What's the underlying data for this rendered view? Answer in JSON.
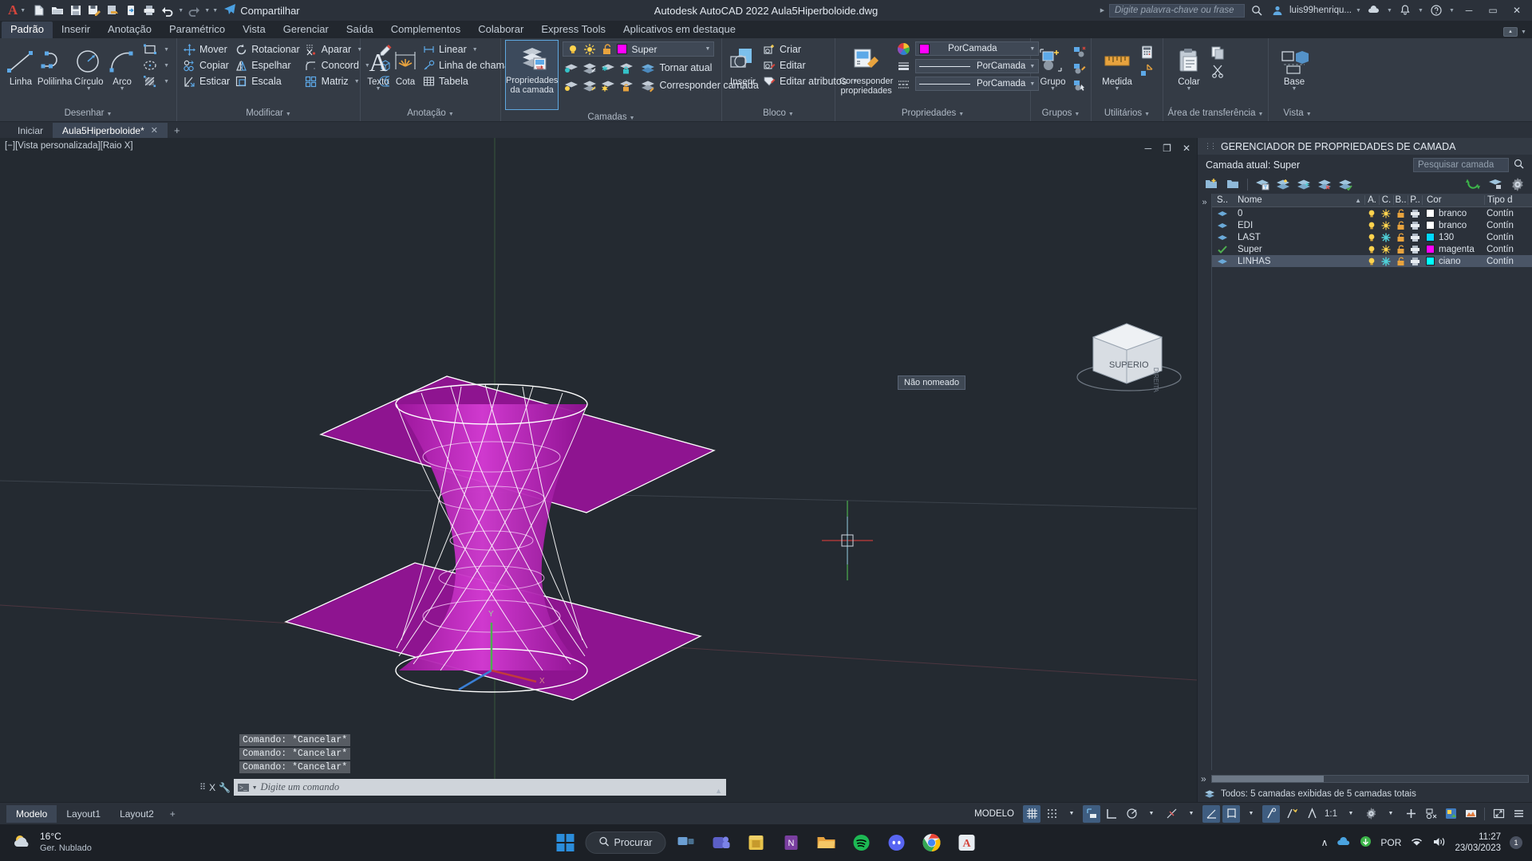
{
  "titlebar": {
    "app_logo": "autocad-a-logo",
    "quick_access": [
      {
        "name": "new-icon",
        "label": "Novo"
      },
      {
        "name": "open-icon",
        "label": "Abrir"
      },
      {
        "name": "save-icon",
        "label": "Salvar"
      },
      {
        "name": "saveas-icon",
        "label": "Salvar como"
      },
      {
        "name": "export-icon",
        "label": "Exportar"
      },
      {
        "name": "cloud-icon",
        "label": "Web e Mobile"
      },
      {
        "name": "plot-icon",
        "label": "Plotar"
      },
      {
        "name": "undo-icon",
        "label": "Desfazer"
      },
      {
        "name": "redo-icon",
        "label": "Refazer"
      }
    ],
    "share_label": "Compartilhar",
    "title": "Autodesk AutoCAD 2022    Aula5Hiperboloide.dwg",
    "search_placeholder": "Digite palavra-chave ou frase",
    "user_label": "luis99henriqu...",
    "window_buttons": [
      "minimize",
      "maximize",
      "close"
    ]
  },
  "menu": {
    "tabs": [
      {
        "label": "Padrão",
        "active": true
      },
      {
        "label": "Inserir",
        "active": false
      },
      {
        "label": "Anotação",
        "active": false
      },
      {
        "label": "Paramétrico",
        "active": false
      },
      {
        "label": "Vista",
        "active": false
      },
      {
        "label": "Gerenciar",
        "active": false
      },
      {
        "label": "Saída",
        "active": false
      },
      {
        "label": "Complementos",
        "active": false
      },
      {
        "label": "Colaborar",
        "active": false
      },
      {
        "label": "Express Tools",
        "active": false
      },
      {
        "label": "Aplicativos em destaque",
        "active": false
      }
    ]
  },
  "ribbon": {
    "panels": [
      {
        "title": "Desenhar",
        "big": [
          {
            "label": "Linha",
            "icon": "line-icon"
          },
          {
            "label": "Polilinha",
            "icon": "polyline-icon"
          },
          {
            "label": "Círculo",
            "icon": "circle-icon",
            "dropdown": true
          },
          {
            "label": "Arco",
            "icon": "arc-icon",
            "dropdown": true
          }
        ],
        "small": [
          {
            "label": "",
            "icon": "rectangle-icon",
            "dropdown": true
          },
          {
            "label": "",
            "icon": "ellipse-icon",
            "dropdown": true
          },
          {
            "label": "",
            "icon": "hatch-icon",
            "dropdown": true
          }
        ]
      },
      {
        "title": "Modificar",
        "rows": [
          [
            {
              "label": "Mover",
              "icon": "move-icon"
            },
            {
              "label": "Rotacionar",
              "icon": "rotate-icon"
            },
            {
              "label": "Aparar",
              "icon": "trim-icon",
              "dropdown": true
            },
            {
              "label": "",
              "icon": "erase-icon"
            }
          ],
          [
            {
              "label": "Copiar",
              "icon": "copy-icon"
            },
            {
              "label": "Espelhar",
              "icon": "mirror-icon"
            },
            {
              "label": "Concord",
              "icon": "fillet-icon",
              "dropdown": true
            },
            {
              "label": "",
              "icon": "3dsolid-icon"
            }
          ],
          [
            {
              "label": "Esticar",
              "icon": "stretch-icon"
            },
            {
              "label": "Escala",
              "icon": "scale-icon"
            },
            {
              "label": "Matriz",
              "icon": "array-icon",
              "dropdown": true
            },
            {
              "label": "",
              "icon": "offset-icon"
            }
          ]
        ]
      },
      {
        "title": "Anotação",
        "big": [
          {
            "label": "Texto",
            "icon": "text-icon",
            "dropdown": true
          },
          {
            "label": "Cota",
            "icon": "dimension-icon"
          }
        ],
        "rows": [
          [
            {
              "label": "Linear",
              "icon": "linear-dim-icon",
              "dropdown": true
            }
          ],
          [
            {
              "label": "Linha de chamada",
              "icon": "leader-icon",
              "dropdown": true
            }
          ],
          [
            {
              "label": "Tabela",
              "icon": "table-icon"
            }
          ]
        ]
      },
      {
        "title": "Camadas",
        "big": [
          {
            "label": "Propriedades da camada",
            "icon": "layer-properties-icon",
            "active": true
          }
        ],
        "layer_combo": {
          "name": "Super",
          "color": "#ff00ff",
          "on": true,
          "freeze": false,
          "lock": false
        },
        "rows": [
          [
            {
              "label": "Tornar atual",
              "icon": "layer-make-current-icon"
            }
          ],
          [
            {
              "label": "Corresponder camada",
              "icon": "layer-match-icon"
            }
          ]
        ],
        "state_icons_row1": [
          "layer-isolate-icon",
          "layer-unisolate-icon",
          "layer-freeze-icon",
          "layer-lock-icon"
        ],
        "state_icons_row2": [
          "layer-off-icon",
          "layer-turn-on-icon",
          "layer-thaw-icon",
          "layer-unlock-icon"
        ]
      },
      {
        "title": "Bloco",
        "big": [
          {
            "label": "Inserir",
            "icon": "insert-block-icon",
            "dropdown": true
          }
        ],
        "rows": [
          [
            {
              "label": "Criar",
              "icon": "block-create-icon"
            }
          ],
          [
            {
              "label": "Editar",
              "icon": "block-edit-icon"
            }
          ],
          [
            {
              "label": "Editar atributos",
              "icon": "block-attrib-icon",
              "dropdown": true
            }
          ]
        ]
      },
      {
        "title": "Propriedades",
        "big": [
          {
            "label": "Corresponder propriedades",
            "icon": "match-properties-icon"
          }
        ],
        "combos": [
          {
            "label": "PorCamada",
            "icon": "color-wheel-icon",
            "swatch": "#ff00ff"
          },
          {
            "label": "PorCamada",
            "icon": "lineweight-icon",
            "line": true
          },
          {
            "label": "PorCamada",
            "icon": "linetype-icon",
            "line": true
          }
        ]
      },
      {
        "title": "Grupos",
        "big": [
          {
            "label": "Grupo",
            "icon": "group-icon",
            "dropdown": true
          }
        ],
        "small": [
          {
            "icon": "ungroup-icon"
          },
          {
            "icon": "group-edit-icon"
          },
          {
            "icon": "group-select-icon"
          }
        ]
      },
      {
        "title": "Utilitários",
        "big": [
          {
            "label": "Medida",
            "icon": "measure-icon",
            "dropdown": true
          }
        ],
        "small": [
          {
            "icon": "quickcalc-icon"
          },
          {
            "icon": "id-point-icon"
          }
        ]
      },
      {
        "title": "Área de transferência",
        "big": [
          {
            "label": "Colar",
            "icon": "paste-icon",
            "dropdown": true
          }
        ],
        "small": [
          {
            "icon": "copy-clip-icon"
          },
          {
            "icon": "cut-clip-icon"
          }
        ]
      },
      {
        "title": "Vista",
        "big": [
          {
            "label": "Base",
            "icon": "base-view-icon",
            "dropdown": true
          }
        ]
      }
    ]
  },
  "doctabs": {
    "tabs": [
      {
        "label": "Iniciar",
        "active": false,
        "closable": false
      },
      {
        "label": "Aula5Hiperboloide*",
        "active": true,
        "closable": true
      }
    ],
    "add_label": "+"
  },
  "viewport": {
    "label": "[−][Vista personalizada][Raio X]",
    "viewcube_face": "SUPERIOR",
    "viewcube_side": "DIREITA",
    "tooltip": "Não nomeado",
    "controls": [
      "minimize",
      "restore",
      "close"
    ],
    "model_color_main": "#a0179f",
    "model_color_light": "#c92fc8",
    "wire_color": "#ffffff"
  },
  "command": {
    "history": [
      "Comando: *Cancelar*",
      "Comando: *Cancelar*",
      "Comando: *Cancelar*"
    ],
    "placeholder": "Digite um comando",
    "close_label": "X"
  },
  "palette": {
    "title": "GERENCIADOR DE PROPRIEDADES DE CAMADA",
    "current_layer": "Camada atual: Super",
    "search_placeholder": "Pesquisar camada",
    "toolbar_icons": [
      "new-layer-icon",
      "new-layer-vp-icon",
      "delete-layer-icon",
      "set-current-icon",
      "new-property-filter-icon",
      "new-group-filter-icon",
      "layer-states-icon"
    ],
    "right_icons": [
      "refresh-icon",
      "apply-icon",
      "settings-icon"
    ],
    "filter_toggle": "»",
    "columns": [
      "S..",
      "Nome",
      "A.",
      "C.",
      "B..",
      "P..",
      "Cor",
      "Tipo d"
    ],
    "rows": [
      {
        "status": "layer",
        "name": "0",
        "on": "on",
        "freeze": "thaw",
        "lock": "unlocked",
        "plot": "plot",
        "color_name": "branco",
        "color": "#ffffff",
        "linetype": "Contín",
        "selected": false,
        "current": false
      },
      {
        "status": "layer",
        "name": "EDI",
        "on": "on",
        "freeze": "thaw",
        "lock": "unlocked",
        "plot": "plot",
        "color_name": "branco",
        "color": "#ffffff",
        "linetype": "Contín",
        "selected": false,
        "current": false
      },
      {
        "status": "layer",
        "name": "LAST",
        "on": "on",
        "freeze": "frozen",
        "lock": "unlocked",
        "plot": "plot",
        "color_name": "130",
        "color": "#00d8ff",
        "linetype": "Contín",
        "selected": false,
        "current": false
      },
      {
        "status": "current",
        "name": "Super",
        "on": "on",
        "freeze": "thaw",
        "lock": "unlocked",
        "plot": "plot",
        "color_name": "magenta",
        "color": "#ff00ff",
        "linetype": "Contín",
        "selected": false,
        "current": true
      },
      {
        "status": "layer",
        "name": "LINHAS",
        "on": "on",
        "freeze": "frozen",
        "lock": "unlocked",
        "plot": "plot",
        "color_name": "ciano",
        "color": "#00ffff",
        "linetype": "Contín",
        "selected": true,
        "current": false
      }
    ],
    "status_text": "Todos: 5 camadas exibidas de 5 camadas totais",
    "collapse_label": "»"
  },
  "statusbar": {
    "layout_tabs": [
      {
        "label": "Modelo",
        "active": true
      },
      {
        "label": "Layout1",
        "active": false
      },
      {
        "label": "Layout2",
        "active": false
      }
    ],
    "add_layout": "+",
    "space_label": "MODELO",
    "scale": "1:1",
    "toggles": [
      {
        "name": "grid-toggle",
        "on": true
      },
      {
        "name": "snap-toggle",
        "on": false
      },
      {
        "name": "ortho-toggle",
        "on": true
      },
      {
        "name": "polar-tracking-toggle",
        "on": false
      },
      {
        "name": "osnap-toggle",
        "on": false
      },
      {
        "name": "otrack-toggle",
        "on": false
      },
      {
        "name": "ucs-icon-toggle",
        "on": true
      },
      {
        "name": "dynamic-input-toggle",
        "on": true
      },
      {
        "name": "annotation-visibility-toggle",
        "on": true
      },
      {
        "name": "autoscale-toggle",
        "on": false
      },
      {
        "name": "annotation-scale-toggle",
        "on": false
      },
      {
        "name": "workspace-switch",
        "on": false
      },
      {
        "name": "customization-icon",
        "on": false
      },
      {
        "name": "isolate-objects-icon",
        "on": false
      },
      {
        "name": "hardware-accel-icon",
        "on": false
      },
      {
        "name": "cleanscreen-icon",
        "on": false
      }
    ]
  },
  "taskbar": {
    "weather_temp": "16°C",
    "weather_desc": "Ger. Nublado",
    "search_label": "Procurar",
    "apps": [
      {
        "name": "start-icon",
        "label": "Iniciar"
      },
      {
        "name": "search-pill",
        "label": "Procurar"
      },
      {
        "name": "taskview-icon",
        "label": "Visão de tarefas"
      },
      {
        "name": "teams-icon",
        "label": "Teams"
      },
      {
        "name": "store-icon",
        "label": "Microsoft Store"
      },
      {
        "name": "onenote-icon",
        "label": "OneNote"
      },
      {
        "name": "explorer-icon",
        "label": "Explorador de Arquivos"
      },
      {
        "name": "spotify-icon",
        "label": "Spotify"
      },
      {
        "name": "discord-icon",
        "label": "Discord"
      },
      {
        "name": "chrome-icon",
        "label": "Google Chrome"
      },
      {
        "name": "autocad-icon",
        "label": "AutoCAD"
      }
    ],
    "tray": {
      "language": "POR",
      "time": "11:27",
      "date": "23/03/2023",
      "notification_count": "1"
    }
  }
}
